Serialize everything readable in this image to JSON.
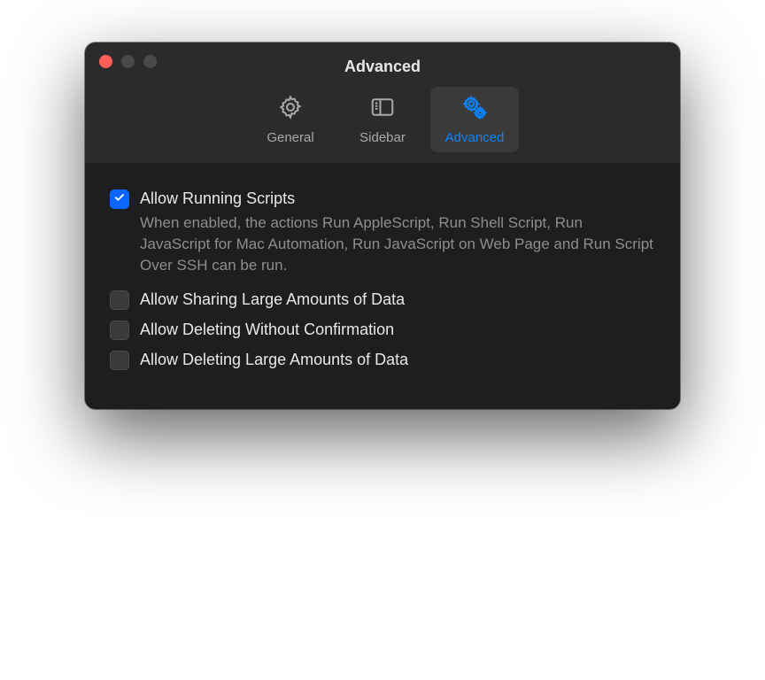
{
  "window": {
    "title": "Advanced"
  },
  "tabs": {
    "general": {
      "label": "General",
      "active": false
    },
    "sidebar": {
      "label": "Sidebar",
      "active": false
    },
    "advanced": {
      "label": "Advanced",
      "active": true
    }
  },
  "settings": {
    "allow_running_scripts": {
      "label": "Allow Running Scripts",
      "checked": true,
      "description": "When enabled, the actions Run AppleScript, Run Shell Script, Run JavaScript for Mac Automation, Run JavaScript on Web Page and Run Script Over SSH can be run."
    },
    "allow_sharing_large": {
      "label": "Allow Sharing Large Amounts of Data",
      "checked": false
    },
    "allow_deleting_no_confirm": {
      "label": "Allow Deleting Without Confirmation",
      "checked": false
    },
    "allow_deleting_large": {
      "label": "Allow Deleting Large Amounts of Data",
      "checked": false
    }
  },
  "colors": {
    "accent": "#0a84ff",
    "window_bg": "#1e1e1e",
    "titlebar_bg": "#2b2b2b"
  }
}
